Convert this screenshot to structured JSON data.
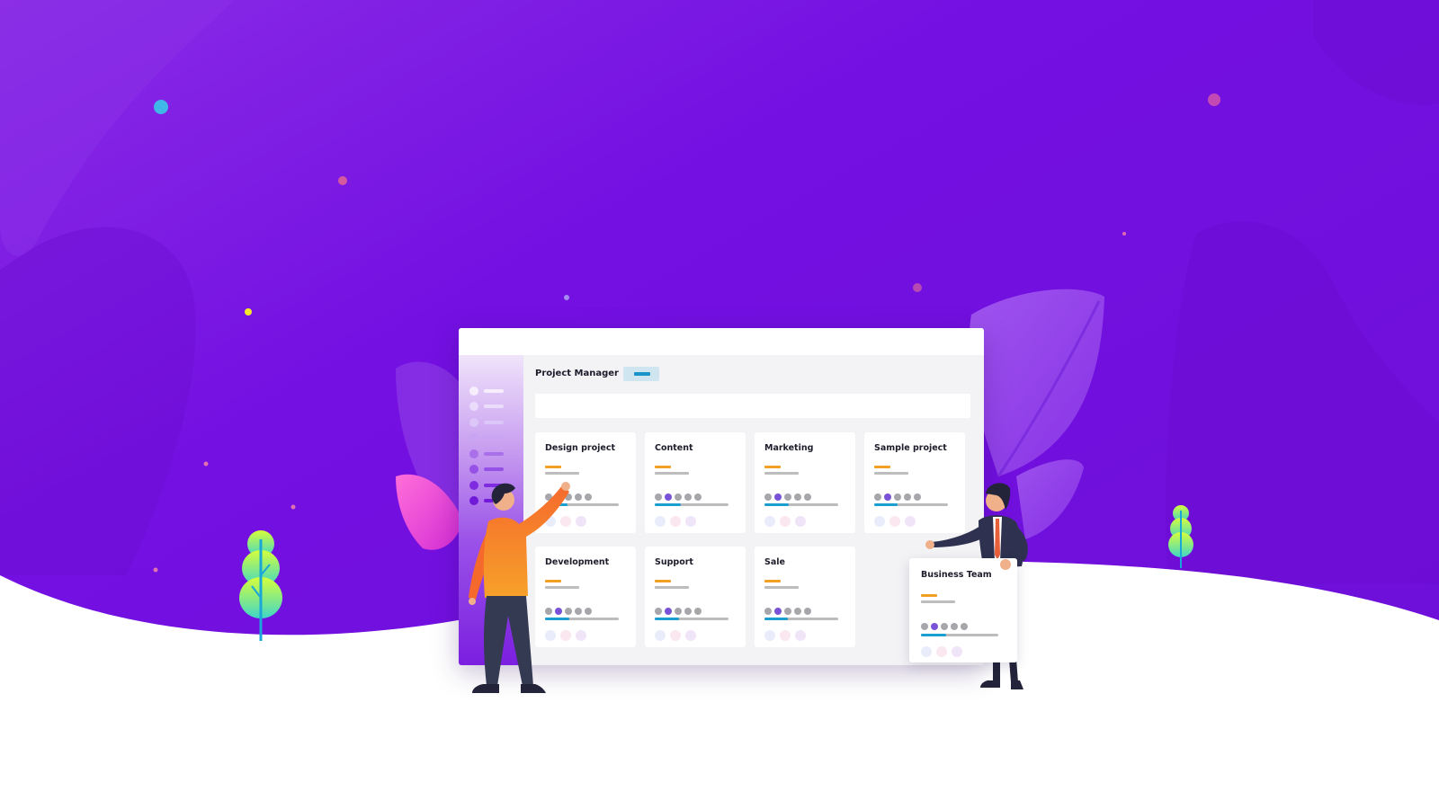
{
  "window": {
    "app_title": "Project Manager",
    "sidebar_items": 8
  },
  "projects": [
    {
      "name": "Design project",
      "active_dot": 1,
      "progress": 0.3
    },
    {
      "name": "Content",
      "active_dot": 1,
      "progress": 0.35
    },
    {
      "name": "Marketing",
      "active_dot": 1,
      "progress": 0.33
    },
    {
      "name": "Sample project",
      "active_dot": 1,
      "progress": 0.32
    },
    {
      "name": "Development",
      "active_dot": 1,
      "progress": 0.33
    },
    {
      "name": "Support",
      "active_dot": 1,
      "progress": 0.33
    },
    {
      "name": "Sale",
      "active_dot": 1,
      "progress": 0.32
    }
  ],
  "business_card": {
    "name": "Business Team",
    "active_dot": 1,
    "progress": 0.33
  },
  "colors": {
    "background": "#7a10e0",
    "accent_orange": "#f2a023",
    "accent_blue": "#1b9ed0",
    "accent_purple": "#7a52d8"
  },
  "icons": {
    "person_left": "person-pointing-icon",
    "person_right": "businessman-presenting-icon",
    "tree": "tree-icon",
    "leaf": "leaf-icon"
  }
}
